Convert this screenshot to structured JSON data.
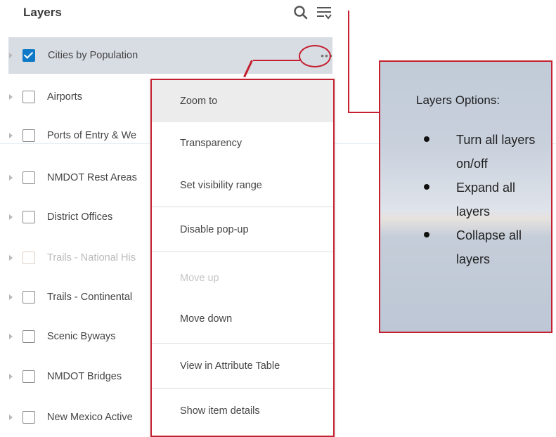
{
  "header": {
    "title": "Layers",
    "search_icon": "search-icon",
    "filter_icon": "filter-icon"
  },
  "layers": [
    {
      "label": "Cities by Population",
      "checked": true,
      "selected": true
    },
    {
      "label": "Airports",
      "checked": false
    },
    {
      "label": "Ports of Entry & We",
      "checked": false
    },
    {
      "label": "NMDOT Rest Areas",
      "checked": false
    },
    {
      "label": "District Offices",
      "checked": false
    },
    {
      "label": "Trails - National His",
      "checked": false,
      "faded": true
    },
    {
      "label": "Trails - Continental",
      "checked": false
    },
    {
      "label": "Scenic Byways",
      "checked": false
    },
    {
      "label": "NMDOT Bridges",
      "checked": false
    },
    {
      "label": "New Mexico Active",
      "checked": false
    }
  ],
  "more_button": {
    "label": "•••"
  },
  "context_menu": {
    "items": [
      {
        "label": "Zoom to"
      },
      {
        "label": "Transparency"
      },
      {
        "label": "Set visibility range"
      },
      {
        "label": "Disable pop-up"
      },
      {
        "label": "Move up",
        "disabled": true
      },
      {
        "label": "Move down"
      },
      {
        "label": "View in Attribute Table"
      },
      {
        "label": "Show item details"
      }
    ]
  },
  "callout": {
    "title": "Layers Options:",
    "bullets": [
      "Turn all layers on/off",
      "Expand all layers",
      "Collapse all layers"
    ]
  },
  "colors": {
    "accent": "#0f79c7",
    "highlight_red": "#c4202f",
    "selected_row": "#d8dde4"
  }
}
